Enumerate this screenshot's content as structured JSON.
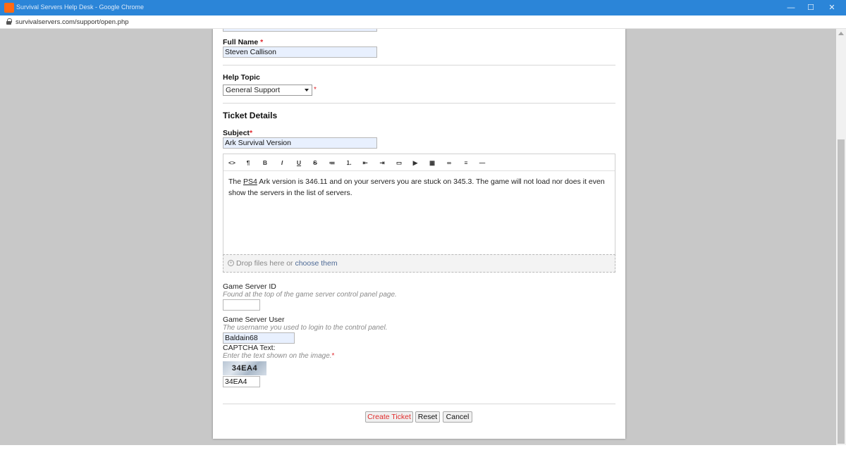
{
  "window": {
    "title": "Survival Servers Help Desk - Google Chrome",
    "minimize_icon": "minimize-icon",
    "maximize_icon": "maximize-icon",
    "close_icon": "close-icon"
  },
  "address_bar": {
    "url": "survivalservers.com/support/open.php"
  },
  "form": {
    "full_name": {
      "label": "Full Name",
      "required_mark": "*",
      "value": "Steven Callison"
    },
    "help_topic": {
      "label": "Help Topic",
      "selected": "General Support",
      "required_mark": "*"
    },
    "ticket_details_heading": "Ticket Details",
    "subject": {
      "label": "Subject",
      "required_mark": "*",
      "value": "Ark Survival Version"
    },
    "editor": {
      "toolbar": [
        {
          "name": "code-view-icon",
          "glyph": "<>"
        },
        {
          "name": "paragraph-icon",
          "glyph": "¶"
        },
        {
          "name": "bold-icon",
          "glyph": "B"
        },
        {
          "name": "italic-icon",
          "glyph": "I"
        },
        {
          "name": "underline-icon",
          "glyph": "U"
        },
        {
          "name": "strikethrough-icon",
          "glyph": "S"
        },
        {
          "name": "unordered-list-icon",
          "glyph": "≔"
        },
        {
          "name": "ordered-list-icon",
          "glyph": "⒈"
        },
        {
          "name": "outdent-icon",
          "glyph": "⇤"
        },
        {
          "name": "indent-icon",
          "glyph": "⇥"
        },
        {
          "name": "image-icon",
          "glyph": "▭"
        },
        {
          "name": "video-icon",
          "glyph": "▶"
        },
        {
          "name": "table-icon",
          "glyph": "▦"
        },
        {
          "name": "link-icon",
          "glyph": "∞"
        },
        {
          "name": "align-icon",
          "glyph": "≡"
        },
        {
          "name": "horizontal-rule-icon",
          "glyph": "—"
        }
      ],
      "body_prefix": "The ",
      "body_link": "PS4",
      "body_rest": " Ark version is 346.11 and on your servers you are stuck on 345.3. The game will not load nor does it even show the servers in the list of servers."
    },
    "dropzone": {
      "text": "Drop files here or ",
      "link": "choose them"
    },
    "game_server_id": {
      "label": "Game Server ID",
      "hint": "Found at the top of the game server control panel page.",
      "value": ""
    },
    "game_server_user": {
      "label": "Game Server User",
      "hint": "The username you used to login to the control panel.",
      "value": "Baldain68"
    },
    "captcha": {
      "label": "CAPTCHA Text:",
      "hint": "Enter the text shown on the image.",
      "required_mark": "*",
      "image_text": "34EA4",
      "value": "34EA4"
    },
    "buttons": {
      "create": "Create Ticket",
      "reset": "Reset",
      "cancel": "Cancel"
    }
  },
  "colors": {
    "titlebar": "#2b85d8",
    "required": "#e0262c",
    "autofill_bg": "#e8f0fe",
    "link": "#4d6a96"
  }
}
